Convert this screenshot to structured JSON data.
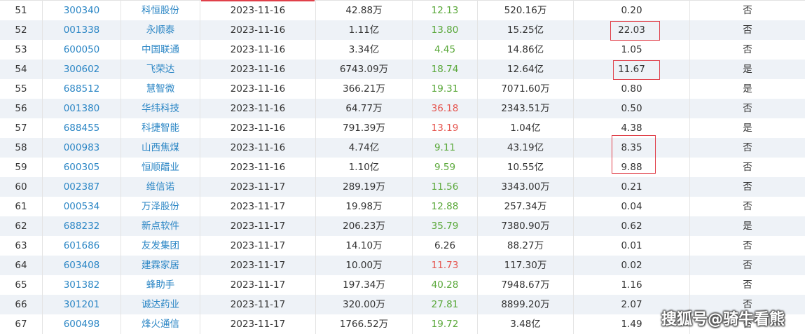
{
  "table": {
    "rows": [
      {
        "index": "51",
        "code": "300340",
        "name": "科恒股份",
        "date": "2023-11-16",
        "amount": "42.88万",
        "price": "12.13",
        "price_color": "green",
        "market_cap": "520.16万",
        "ratio": "0.20",
        "flag": "否"
      },
      {
        "index": "52",
        "code": "001338",
        "name": "永顺泰",
        "date": "2023-11-16",
        "amount": "1.11亿",
        "price": "13.80",
        "price_color": "green",
        "market_cap": "15.25亿",
        "ratio": "22.03",
        "flag": "否"
      },
      {
        "index": "53",
        "code": "600050",
        "name": "中国联通",
        "date": "2023-11-16",
        "amount": "3.34亿",
        "price": "4.45",
        "price_color": "green",
        "market_cap": "14.86亿",
        "ratio": "1.05",
        "flag": "否"
      },
      {
        "index": "54",
        "code": "300602",
        "name": "飞荣达",
        "date": "2023-11-16",
        "amount": "6743.09万",
        "price": "18.74",
        "price_color": "green",
        "market_cap": "12.64亿",
        "ratio": "11.67",
        "flag": "是"
      },
      {
        "index": "55",
        "code": "688512",
        "name": "慧智微",
        "date": "2023-11-16",
        "amount": "366.21万",
        "price": "19.31",
        "price_color": "green",
        "market_cap": "7071.60万",
        "ratio": "0.80",
        "flag": "是"
      },
      {
        "index": "56",
        "code": "001380",
        "name": "华纬科技",
        "date": "2023-11-16",
        "amount": "64.77万",
        "price": "36.18",
        "price_color": "red",
        "market_cap": "2343.51万",
        "ratio": "0.50",
        "flag": "否"
      },
      {
        "index": "57",
        "code": "688455",
        "name": "科捷智能",
        "date": "2023-11-16",
        "amount": "791.39万",
        "price": "13.19",
        "price_color": "red",
        "market_cap": "1.04亿",
        "ratio": "4.38",
        "flag": "是"
      },
      {
        "index": "58",
        "code": "000983",
        "name": "山西焦煤",
        "date": "2023-11-16",
        "amount": "4.74亿",
        "price": "9.11",
        "price_color": "green",
        "market_cap": "43.19亿",
        "ratio": "8.35",
        "flag": "否"
      },
      {
        "index": "59",
        "code": "600305",
        "name": "恒顺醋业",
        "date": "2023-11-16",
        "amount": "1.10亿",
        "price": "9.59",
        "price_color": "green",
        "market_cap": "10.55亿",
        "ratio": "9.88",
        "flag": "否"
      },
      {
        "index": "60",
        "code": "002387",
        "name": "维信诺",
        "date": "2023-11-17",
        "amount": "289.19万",
        "price": "11.56",
        "price_color": "green",
        "market_cap": "3343.00万",
        "ratio": "0.21",
        "flag": "否"
      },
      {
        "index": "61",
        "code": "000534",
        "name": "万泽股份",
        "date": "2023-11-17",
        "amount": "19.98万",
        "price": "12.88",
        "price_color": "green",
        "market_cap": "257.34万",
        "ratio": "0.04",
        "flag": "否"
      },
      {
        "index": "62",
        "code": "688232",
        "name": "新点软件",
        "date": "2023-11-17",
        "amount": "206.23万",
        "price": "35.79",
        "price_color": "green",
        "market_cap": "7380.90万",
        "ratio": "0.62",
        "flag": "是"
      },
      {
        "index": "63",
        "code": "601686",
        "name": "友发集团",
        "date": "2023-11-17",
        "amount": "14.10万",
        "price": "6.26",
        "price_color": "neutral",
        "market_cap": "88.27万",
        "ratio": "0.01",
        "flag": "否"
      },
      {
        "index": "64",
        "code": "603408",
        "name": "建霖家居",
        "date": "2023-11-17",
        "amount": "10.00万",
        "price": "11.73",
        "price_color": "red",
        "market_cap": "117.30万",
        "ratio": "0.02",
        "flag": "否"
      },
      {
        "index": "65",
        "code": "301382",
        "name": "蜂助手",
        "date": "2023-11-17",
        "amount": "197.34万",
        "price": "40.28",
        "price_color": "green",
        "market_cap": "7948.67万",
        "ratio": "1.16",
        "flag": "否"
      },
      {
        "index": "66",
        "code": "301201",
        "name": "诚达药业",
        "date": "2023-11-17",
        "amount": "320.00万",
        "price": "27.81",
        "price_color": "green",
        "market_cap": "8899.20万",
        "ratio": "2.07",
        "flag": "否"
      },
      {
        "index": "67",
        "code": "600498",
        "name": "烽火通信",
        "date": "2023-11-17",
        "amount": "1766.52万",
        "price": "19.72",
        "price_color": "green",
        "market_cap": "3.48亿",
        "ratio": "1.49",
        "flag": "否"
      }
    ]
  },
  "colors": {
    "link": "#2b86c5",
    "green": "#5aa83a",
    "red": "#e5554f",
    "highlight_box": "#e0404a",
    "alt_row": "#eef2f7"
  },
  "watermark": {
    "text": "搜狐号@骑牛看熊"
  }
}
